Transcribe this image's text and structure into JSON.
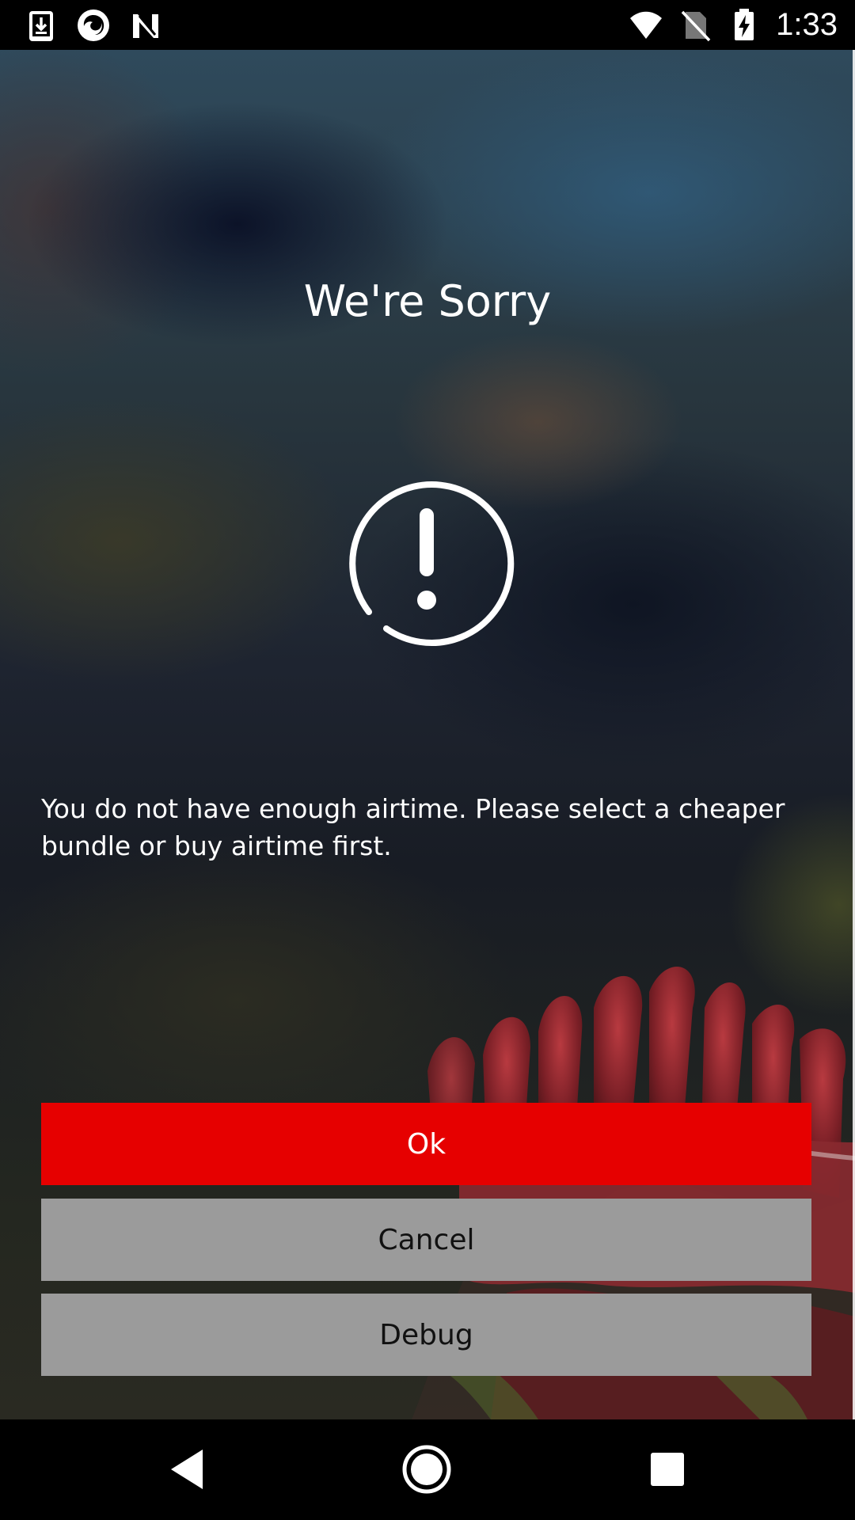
{
  "status_bar": {
    "time": "1:33",
    "left_icons": [
      "download-icon",
      "firefox-icon",
      "n-app-icon"
    ],
    "right_icons": [
      "wifi-icon",
      "no-sim-icon",
      "battery-charging-icon"
    ]
  },
  "dialog": {
    "title": "We're Sorry",
    "icon": "alert-circle-icon",
    "message": "You do not have enough airtime. Please select a cheaper bundle or buy airtime first."
  },
  "buttons": {
    "ok_label": "Ok",
    "cancel_label": "Cancel",
    "debug_label": "Debug"
  },
  "navigation": {
    "items": [
      "back-icon",
      "home-icon",
      "recents-icon"
    ]
  },
  "colors": {
    "primary_button": "#e60000",
    "secondary_button": "#9b9b9b",
    "text": "#ffffff"
  }
}
